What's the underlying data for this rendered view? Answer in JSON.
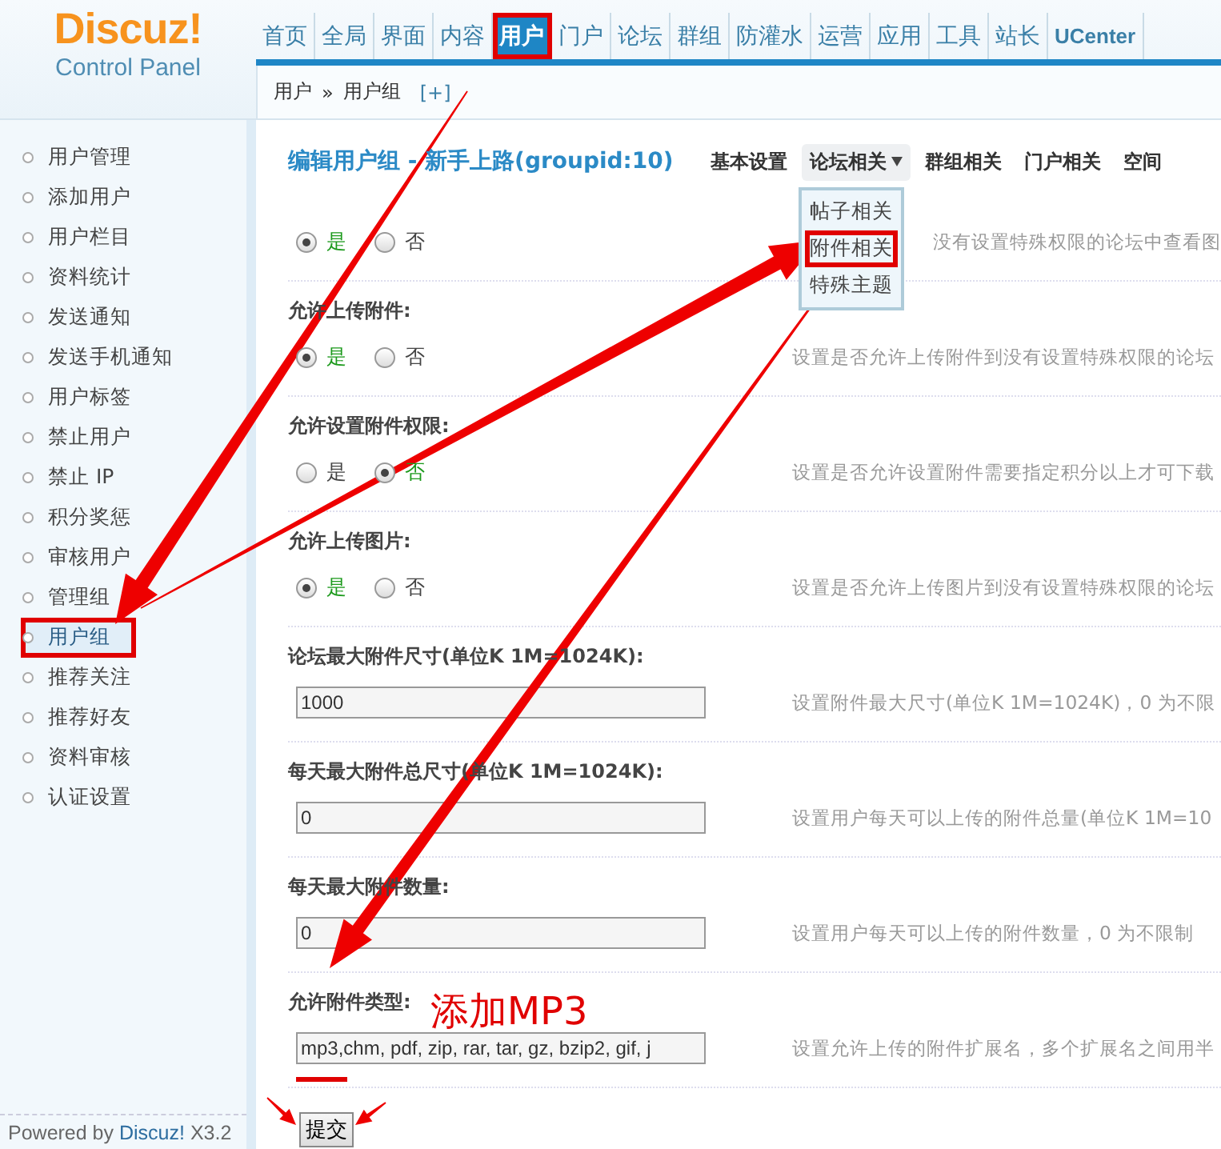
{
  "header": {
    "logo": "Discuz!",
    "subtitle": "Control Panel",
    "nav": [
      {
        "label": "首页",
        "selected": false,
        "annotated": false
      },
      {
        "label": "全局",
        "selected": false,
        "annotated": false
      },
      {
        "label": "界面",
        "selected": false,
        "annotated": false
      },
      {
        "label": "内容",
        "selected": false,
        "annotated": false
      },
      {
        "label": "用户",
        "selected": true,
        "annotated": true
      },
      {
        "label": "门户",
        "selected": false,
        "annotated": false
      },
      {
        "label": "论坛",
        "selected": false,
        "annotated": false
      },
      {
        "label": "群组",
        "selected": false,
        "annotated": false
      },
      {
        "label": "防灌水",
        "selected": false,
        "annotated": false
      },
      {
        "label": "运营",
        "selected": false,
        "annotated": false
      },
      {
        "label": "应用",
        "selected": false,
        "annotated": false
      },
      {
        "label": "工具",
        "selected": false,
        "annotated": false
      },
      {
        "label": "站长",
        "selected": false,
        "annotated": false
      },
      {
        "label": "UCenter",
        "selected": false,
        "annotated": false
      }
    ]
  },
  "breadcrumb": {
    "items": [
      "用户",
      "用户组"
    ],
    "separator": "»",
    "add": "[+]"
  },
  "sidebar": {
    "items": [
      {
        "label": "用户管理",
        "selected": false,
        "annotated": false
      },
      {
        "label": "添加用户",
        "selected": false,
        "annotated": false
      },
      {
        "label": "用户栏目",
        "selected": false,
        "annotated": false
      },
      {
        "label": "资料统计",
        "selected": false,
        "annotated": false
      },
      {
        "label": "发送通知",
        "selected": false,
        "annotated": false
      },
      {
        "label": "发送手机通知",
        "selected": false,
        "annotated": false
      },
      {
        "label": "用户标签",
        "selected": false,
        "annotated": false
      },
      {
        "label": "禁止用户",
        "selected": false,
        "annotated": false
      },
      {
        "label": "禁止 IP",
        "selected": false,
        "annotated": false
      },
      {
        "label": "积分奖惩",
        "selected": false,
        "annotated": false
      },
      {
        "label": "审核用户",
        "selected": false,
        "annotated": false
      },
      {
        "label": "管理组",
        "selected": false,
        "annotated": false
      },
      {
        "label": "用户组",
        "selected": true,
        "annotated": true
      },
      {
        "label": "推荐关注",
        "selected": false,
        "annotated": false
      },
      {
        "label": "推荐好友",
        "selected": false,
        "annotated": false
      },
      {
        "label": "资料审核",
        "selected": false,
        "annotated": false
      },
      {
        "label": "认证设置",
        "selected": false,
        "annotated": false
      }
    ],
    "footer": {
      "before": "Powered by ",
      "link": "Discuz!",
      "after": " X3.2"
    }
  },
  "main": {
    "title": "编辑用户组 - 新手上路(groupid:10)",
    "tabs": [
      {
        "label": "基本设置",
        "selected": false,
        "dropdown": false
      },
      {
        "label": "论坛相关",
        "selected": true,
        "dropdown": true
      },
      {
        "label": "群组相关",
        "selected": false,
        "dropdown": false
      },
      {
        "label": "门户相关",
        "selected": false,
        "dropdown": false
      },
      {
        "label": "空间",
        "selected": false,
        "dropdown": false
      }
    ],
    "menu": {
      "items": [
        {
          "label": "帖子相关",
          "annotated": false
        },
        {
          "label": "附件相关",
          "annotated": true
        },
        {
          "label": "特殊主题",
          "annotated": false
        }
      ]
    },
    "rows": [
      {
        "kind": "radio",
        "options": [
          {
            "label": "是",
            "selected": true
          },
          {
            "label": "否",
            "selected": false
          }
        ],
        "description": "没有设置特殊权限的论坛中查看图"
      },
      {
        "kind": "radio",
        "label": "允许上传附件:",
        "options": [
          {
            "label": "是",
            "selected": true
          },
          {
            "label": "否",
            "selected": false
          }
        ],
        "description": "设置是否允许上传附件到没有设置特殊权限的论坛"
      },
      {
        "kind": "radio",
        "label": "允许设置附件权限:",
        "options": [
          {
            "label": "是",
            "selected": false
          },
          {
            "label": "否",
            "selected": true
          }
        ],
        "description": "设置是否允许设置附件需要指定积分以上才可下载"
      },
      {
        "kind": "radio",
        "label": "允许上传图片:",
        "options": [
          {
            "label": "是",
            "selected": true
          },
          {
            "label": "否",
            "selected": false
          }
        ],
        "description": "设置是否允许上传图片到没有设置特殊权限的论坛"
      },
      {
        "kind": "text",
        "label": "论坛最大附件尺寸(单位K 1M=1024K):",
        "value": "1000",
        "description": "设置附件最大尺寸(单位K 1M=1024K)，0 为不限"
      },
      {
        "kind": "text",
        "label": "每天最大附件总尺寸(单位K 1M=1024K):",
        "value": "0",
        "description": "设置用户每天可以上传的附件总量(单位K 1M=10"
      },
      {
        "kind": "text",
        "label": "每天最大附件数量:",
        "value": "0",
        "description": "设置用户每天可以上传的附件数量，0 为不限制"
      },
      {
        "kind": "text",
        "label": "允许附件类型:",
        "value": "mp3,chm, pdf, zip, rar, tar, gz, bzip2, gif, j",
        "description": "设置允许上传的附件扩展名，多个扩展名之间用半",
        "note": "添加MP3",
        "annotated": true
      }
    ],
    "submit": "提交"
  }
}
